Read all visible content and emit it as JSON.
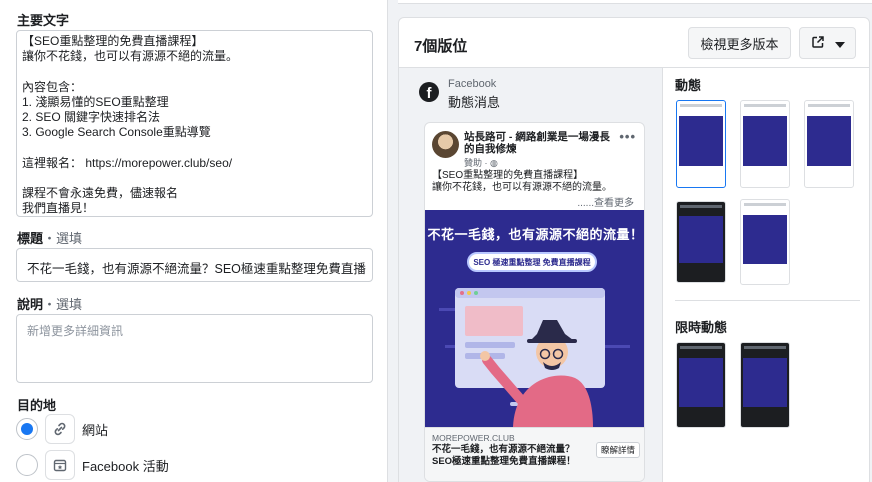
{
  "form": {
    "primary_text_label": "主要文字",
    "primary_text": "【SEO重點整理的免費直播課程】\n讓你不花錢，也可以有源源不絕的流量。\n\n內容包含：\n1. 淺顯易懂的SEO重點整理\n2. SEO 關鍵字快速排名法\n3. Google Search Console重點導覽\n\n這裡報名： https://morepower.club/seo/\n\n課程不會永遠免費，儘速報名\n我們直播見！",
    "headline_label": "標題",
    "headline_optional": "・選填",
    "headline_value": "不花一毛錢，也有源源不絕流量？SEO極速重點整理免費直播",
    "description_label": "說明",
    "description_optional": "・選填",
    "description_placeholder": "新增更多詳細資訊",
    "destination_label": "目的地",
    "destination_options": [
      {
        "label": "網站",
        "selected": true,
        "icon": "link-icon"
      },
      {
        "label": "Facebook 活動",
        "selected": false,
        "icon": "calendar-star-icon"
      }
    ]
  },
  "preview": {
    "title": "7個版位",
    "more_versions_button": "檢視更多版本",
    "placement_source": "Facebook",
    "placement_name": "動態消息",
    "post": {
      "page_name": "站長路可 - 網路創業是一場漫長的自我修煉",
      "sponsored": "贊助",
      "text": "【SEO重點整理的免費直播課程】\n讓你不花錢，也可以有源源不絕的流量。",
      "see_more": "......查看更多",
      "creative_headline": "不花一毛錢，也有源源不絕的流量！",
      "creative_pill": "SEO 極速重點整理 免費直播課程",
      "domain": "MOREPOWER.CLUB",
      "link_title": "不花一毛錢，也有源源不絕流量？SEO極速重點整理免費直播課程！",
      "cta": "瞭解詳情"
    },
    "feeds_title": "動態",
    "stories_title": "限時動態"
  },
  "colors": {
    "accent": "#1877f2",
    "creative_bg": "#2d2b8f"
  }
}
